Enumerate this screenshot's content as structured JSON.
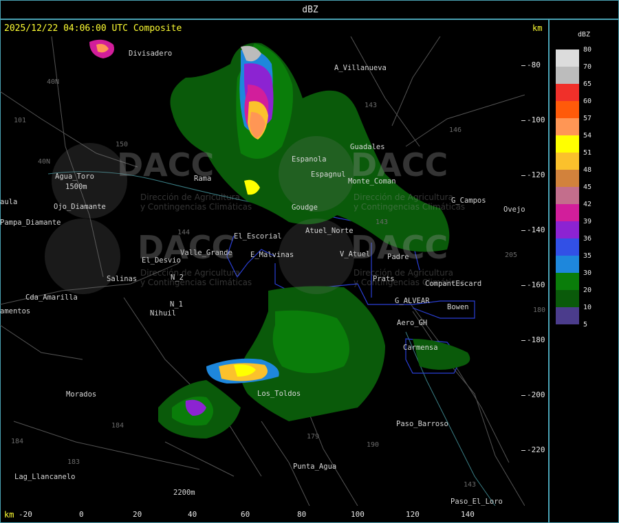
{
  "window": {
    "title": "dBZ"
  },
  "header": {
    "timestamp": "2025/12/22 04:06:00 UTC Composite",
    "unit_top": "km",
    "unit_bottom": "km"
  },
  "axes": {
    "y_ticks": [
      "-80",
      "-100",
      "-120",
      "-140",
      "-160",
      "-180",
      "-200",
      "-220"
    ],
    "x_ticks": [
      "-20",
      "0",
      "20",
      "40",
      "60",
      "80",
      "100",
      "120",
      "140"
    ]
  },
  "legend": {
    "title": "dBZ",
    "entries": [
      {
        "label": "80",
        "color": "#dcdcdc"
      },
      {
        "label": "70",
        "color": "#bcbcbc"
      },
      {
        "label": "65",
        "color": "#f0302a"
      },
      {
        "label": "60",
        "color": "#ff5a0a"
      },
      {
        "label": "57",
        "color": "#ff9655"
      },
      {
        "label": "54",
        "color": "#ffff00"
      },
      {
        "label": "51",
        "color": "#fbc12c"
      },
      {
        "label": "48",
        "color": "#d2823c"
      },
      {
        "label": "45",
        "color": "#c36e8c"
      },
      {
        "label": "42",
        "color": "#d21e9b"
      },
      {
        "label": "39",
        "color": "#8c23d2"
      },
      {
        "label": "36",
        "color": "#3250e6"
      },
      {
        "label": "35",
        "color": "#1e87dc"
      },
      {
        "label": "30",
        "color": "#0a7d0a"
      },
      {
        "label": "20",
        "color": "#0a5a0a"
      },
      {
        "label": "10",
        "color": "#4b3c8c"
      },
      {
        "label": "5",
        "color": ""
      }
    ]
  },
  "places": [
    {
      "name": "Divisadero"
    },
    {
      "name": "A_Villanueva"
    },
    {
      "name": "Guadales"
    },
    {
      "name": "Agua_Toro"
    },
    {
      "name": "1500m"
    },
    {
      "name": "Ojo_Diamante"
    },
    {
      "name": "Pampa_Diamante"
    },
    {
      "name": "aula"
    },
    {
      "name": "Rama"
    },
    {
      "name": "Cda_Amarilla"
    },
    {
      "name": "amentos"
    },
    {
      "name": "Salinas"
    },
    {
      "name": "El_Desvio"
    },
    {
      "name": "Valle_Grande"
    },
    {
      "name": "El_Escorial"
    },
    {
      "name": "E_Malvinas"
    },
    {
      "name": "Nihuil"
    },
    {
      "name": "N_2"
    },
    {
      "name": "N_1"
    },
    {
      "name": "Morados"
    },
    {
      "name": "Los_Toldos"
    },
    {
      "name": "Lag_Llancanelo"
    },
    {
      "name": "Punta_Agua"
    },
    {
      "name": "2200m"
    },
    {
      "name": "Paso_Barroso"
    },
    {
      "name": "Paso_El_Loro"
    },
    {
      "name": "Carmensa"
    },
    {
      "name": "Aero_GH"
    },
    {
      "name": "Bowen"
    },
    {
      "name": "G_ALVEAR"
    },
    {
      "name": "CompantEscard"
    },
    {
      "name": "V_Atuel"
    },
    {
      "name": "Atuel_Norte"
    },
    {
      "name": "G_Campos"
    },
    {
      "name": "Ovejo"
    },
    {
      "name": "Espanola"
    },
    {
      "name": "Espagnul"
    },
    {
      "name": "Monte_Coman"
    },
    {
      "name": "Padre"
    },
    {
      "name": "Prats"
    },
    {
      "name": "Goudge"
    }
  ],
  "route_numbers": [
    "40N",
    "40N",
    "101",
    "144",
    "146",
    "143",
    "150",
    "143",
    "179",
    "190",
    "184",
    "184",
    "183",
    "205",
    "180",
    "143"
  ],
  "watermark": {
    "brand": "DACC",
    "line1": "Dirección de Agricultura",
    "line2": "y Contingencias Climáticas"
  }
}
